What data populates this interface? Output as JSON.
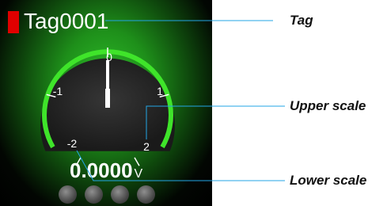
{
  "tag": {
    "name": "Tag0001",
    "status_color": "#e00000"
  },
  "gauge": {
    "tick_labels": [
      "-2",
      "-1",
      "0",
      "1",
      "2"
    ],
    "pointer_value": 0,
    "scale_min": -2,
    "scale_max": 2,
    "value_text": "0.0000",
    "unit": "V",
    "arc_color": "#3fe42a",
    "face_color": "#262626"
  },
  "leds": {
    "count": 4
  },
  "callouts": {
    "tag": "Tag",
    "upper_scale": "Upper scale",
    "lower_scale": "Lower scale",
    "line_color": "#23a6e6"
  }
}
